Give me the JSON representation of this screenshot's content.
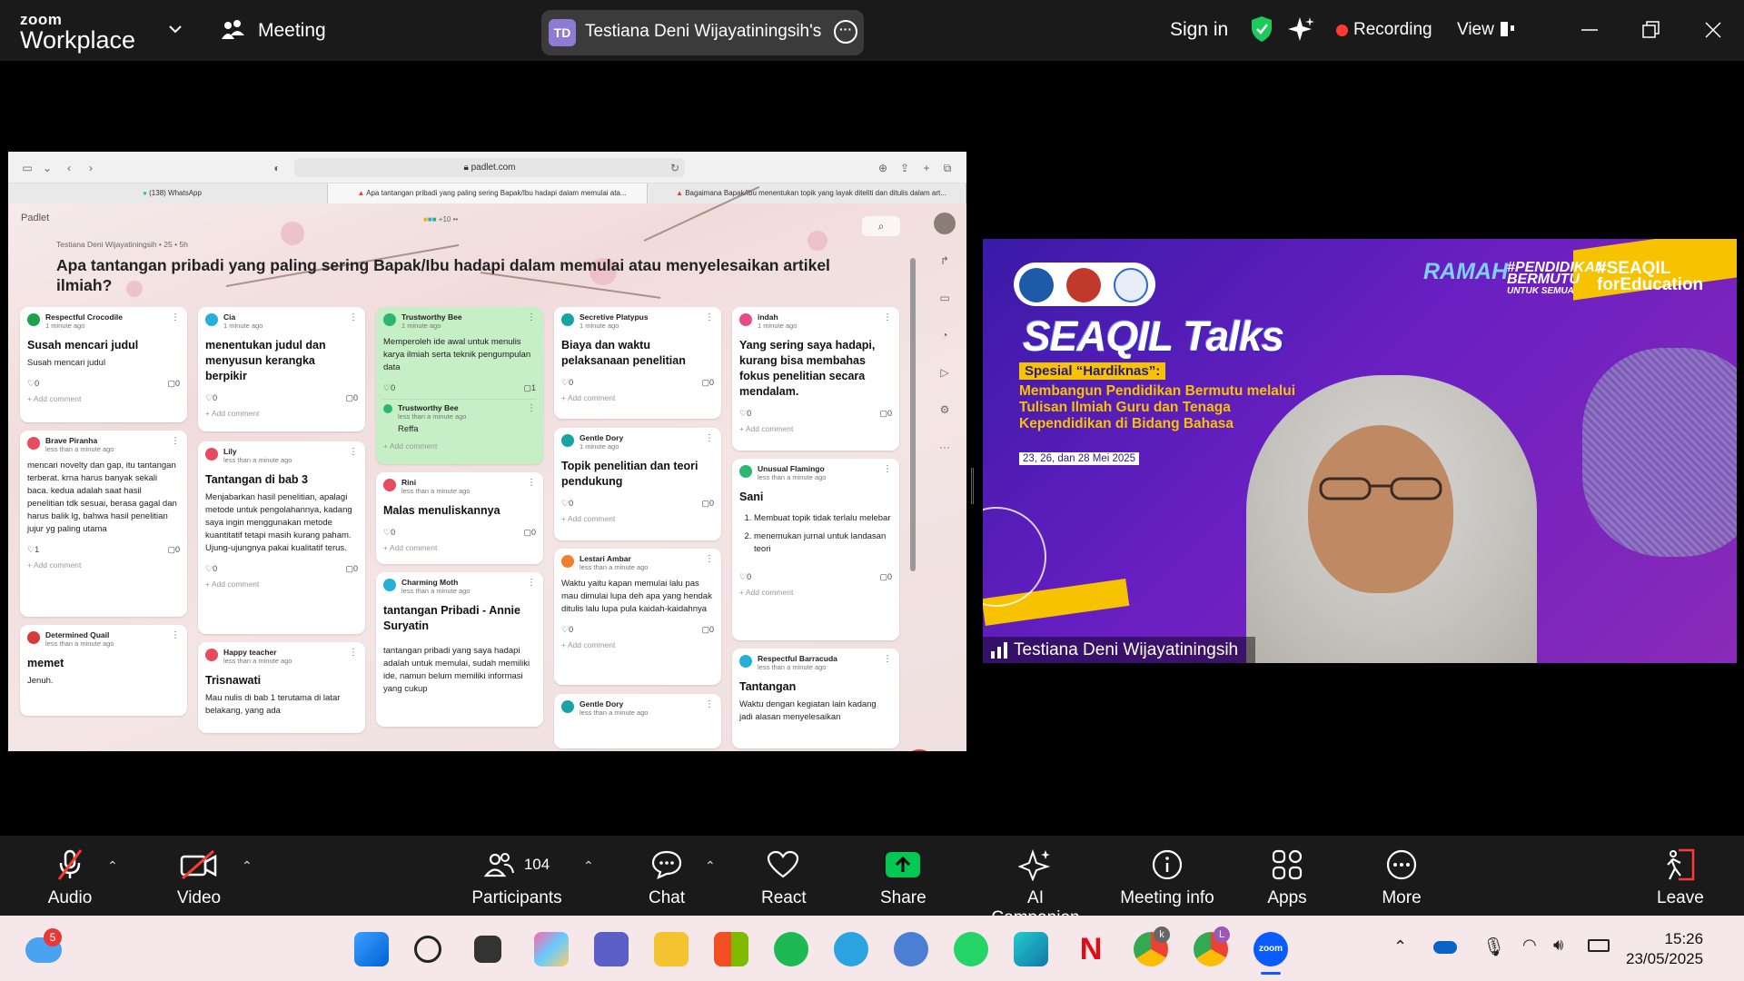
{
  "topbar": {
    "logo_line1": "zoom",
    "logo_line2": "Workplace",
    "meeting_label": "Meeting",
    "share_initials": "TD",
    "share_text": "Testiana Deni Wijayatiningsih's scr",
    "sign_in": "Sign in",
    "recording": "Recording",
    "view": "View"
  },
  "browser": {
    "url": "padlet.com",
    "tabs": [
      {
        "label": "(138) WhatsApp"
      },
      {
        "label": "Apa tantangan pribadi yang paling sering Bapak/Ibu hadapi dalam memulai ata..."
      },
      {
        "label": "Bagaimana Bapak/Ibu menentukan topik yang layak diteliti dan ditulis dalam art..."
      }
    ]
  },
  "padlet": {
    "logo": "Padlet",
    "meta": "Testiana Deni Wijayatiningsih • 25 • 5h",
    "title": "Apa tantangan pribadi yang paling sering Bapak/Ibu hadapi dalam memulai atau menyelesaikan artikel ilmiah?",
    "avatars_count": "+10",
    "add_comment": "Add comment",
    "cards": [
      {
        "author": "Respectful Crocodile",
        "time": "1 minute ago",
        "title": "Susah mencari judul",
        "body": "Susah mencari judul",
        "likes": "0",
        "comments": "0",
        "color": "#1aa34a"
      },
      {
        "author": "Brave Piranha",
        "time": "less than a minute ago",
        "title": "",
        "body": "mencari novelty dan gap, itu tantangan terberat. krna harus banyak sekali baca. kedua adalah saat hasil penelitian tdk sesuai, berasa gagal dan harus balik lg, bahwa hasil penelitian jujur yg paling utama",
        "likes": "1",
        "comments": "0",
        "color": "#e84a5f"
      },
      {
        "author": "Determined Quail",
        "time": "less than a minute ago",
        "title": "memet",
        "body": "Jenuh.",
        "likes": "",
        "comments": "",
        "color": "#d83a3a"
      },
      {
        "author": "Cia",
        "time": "1 minute ago",
        "title": "menentukan judul dan menyusun kerangka berpikir",
        "body": "",
        "likes": "0",
        "comments": "0",
        "color": "#26b0d9"
      },
      {
        "author": "Lily",
        "time": "less than a minute ago",
        "title": "Tantangan di bab 3",
        "body": "Menjabarkan hasil penelitian, apalagi metode untuk pengolahannya, kadang saya ingin menggunakan metode kuantitatif tetapi masih kurang paham. Ujung-ujungnya pakai kualitatif terus.",
        "likes": "0",
        "comments": "0",
        "color": "#e84a5f"
      },
      {
        "author": "Happy teacher",
        "time": "less than a minute ago",
        "title": "Trisnawati",
        "body": "Mau nulis di bab 1 terutama di latar belakang, yang ada",
        "likes": "",
        "comments": "",
        "color": "#e84a5f"
      },
      {
        "author": "Trustworthy Bee",
        "time": "1 minute ago",
        "title": "",
        "body": "Memperoleh ide awal untuk menulis karya ilmiah serta teknik pengumpulan data",
        "likes": "0",
        "comments": "1",
        "color": "#2bb673",
        "reply_author": "Trustworthy Bee",
        "reply_time": "less than a minute ago",
        "reply_text": "Reffa"
      },
      {
        "author": "Rini",
        "time": "less than a minute ago",
        "title": "Malas menuliskannya",
        "body": "",
        "likes": "0",
        "comments": "0",
        "color": "#e84a5f"
      },
      {
        "author": "Charming Moth",
        "time": "less than a minute ago",
        "title": "tantangan Pribadi - Annie Suryatin",
        "body": "tantangan pribadi yang saya hadapi adalah untuk memulai, sudah memiliki ide, namun belum memiliki informasi yang cukup",
        "likes": "",
        "comments": "",
        "color": "#26b0d9"
      },
      {
        "author": "Secretive Platypus",
        "time": "1 minute ago",
        "title": "Biaya dan waktu pelaksanaan penelitian",
        "body": "",
        "likes": "0",
        "comments": "0",
        "color": "#1aa3a3"
      },
      {
        "author": "Gentle Dory",
        "time": "1 minute ago",
        "title": "Topik penelitian dan teori pendukung",
        "body": "",
        "likes": "0",
        "comments": "0",
        "color": "#1aa3a3"
      },
      {
        "author": "Lestari Ambar",
        "time": "less than a minute ago",
        "title": "",
        "body": "Waktu yaitu kapan memulai lalu pas mau dimulai lupa deh apa yang hendak ditulis lalu lupa pula kaidah-kaidahnya",
        "likes": "0",
        "comments": "0",
        "color": "#f08030"
      },
      {
        "author": "Gentle Dory",
        "time": "less than a minute ago",
        "title": "",
        "body": "",
        "likes": "",
        "comments": "",
        "color": "#1aa3a3"
      },
      {
        "author": "indah",
        "time": "1 minute ago",
        "title": "Yang sering saya hadapi, kurang bisa membahas fokus penelitian secara mendalam.",
        "body": "",
        "likes": "0",
        "comments": "0",
        "color": "#e84a8a"
      },
      {
        "author": "Unusual Flamingo",
        "time": "less than a minute ago",
        "title": "Sani",
        "body": "",
        "list": [
          "Membuat topik tidak terlalu melebar",
          "menemukan jurnal untuk landasan teori"
        ],
        "likes": "0",
        "comments": "0",
        "color": "#2bb673"
      },
      {
        "author": "Respectful Barracuda",
        "time": "less than a minute ago",
        "title": "Tantangan",
        "body": "Waktu dengan kegiatan lain kadang jadi alasan menyelesaikan",
        "likes": "",
        "comments": "",
        "color": "#26b0d9"
      }
    ]
  },
  "video": {
    "ramah": "RAMAH",
    "hash1a": "#PENDIDIKAN",
    "hash1b": "BERMUTU",
    "hash1c": "UNTUK SEMUA",
    "hash2a": "#SEAQIL",
    "hash2b": "forEducation",
    "talks": "SEAQIL Talks",
    "special": "Spesial “Hardiknas”:",
    "subtitle": "Membangun Pendidikan Bermutu melalui Tulisan Ilmiah Guru dan Tenaga Kependidikan di Bidang Bahasa",
    "dates": "23, 26, dan 28 Mei 2025",
    "participant_name": "Testiana Deni Wijayatiningsih"
  },
  "toolbar": {
    "audio": "Audio",
    "video": "Video",
    "participants": "Participants",
    "participants_count": "104",
    "chat": "Chat",
    "react": "React",
    "share": "Share",
    "ai_companion": "AI Companion",
    "meeting_info": "Meeting info",
    "apps": "Apps",
    "more": "More",
    "leave": "Leave"
  },
  "taskbar": {
    "weather_badge": "5",
    "chrome_badge1": "k",
    "chrome_badge2": "L",
    "time": "15:26",
    "date": "23/05/2025"
  },
  "colors": {
    "recording": "#ff3b30",
    "share_green": "#00c853",
    "padlet_fab": "#e53935",
    "video_purple": "#6a1fc2",
    "accent_yellow": "#f7c300"
  }
}
